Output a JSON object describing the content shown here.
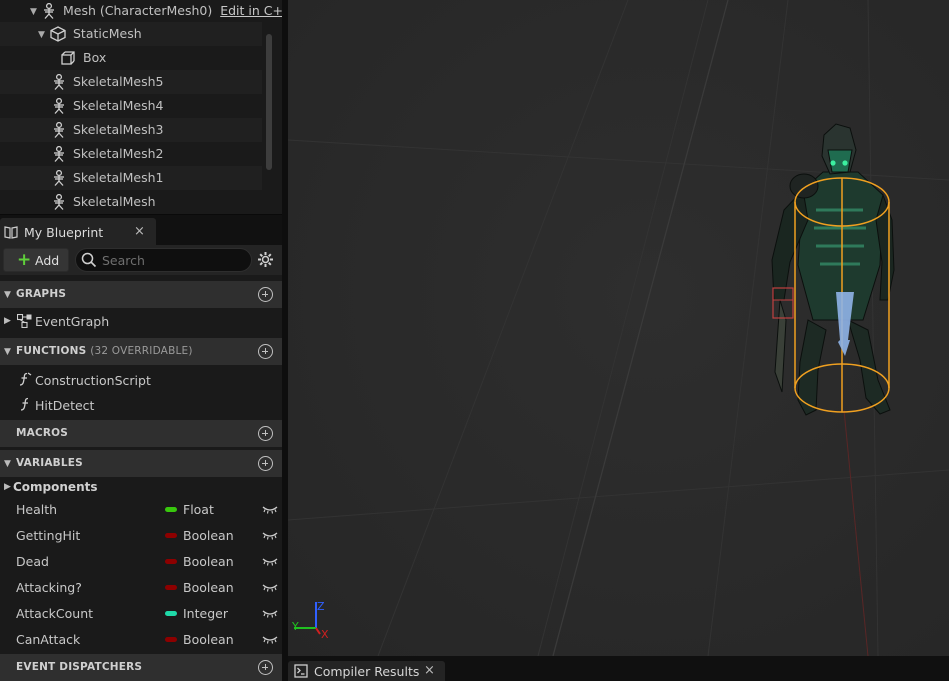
{
  "component_tree": {
    "rows": [
      {
        "label": "Mesh (CharacterMesh0)",
        "icon": "skeleton-icon",
        "edit_link": "Edit in C+"
      },
      {
        "label": "StaticMesh",
        "icon": "cube-icon"
      },
      {
        "label": "Box",
        "icon": "box-collision-icon"
      },
      {
        "label": "SkeletalMesh5",
        "icon": "skeleton-icon"
      },
      {
        "label": "SkeletalMesh4",
        "icon": "skeleton-icon"
      },
      {
        "label": "SkeletalMesh3",
        "icon": "skeleton-icon"
      },
      {
        "label": "SkeletalMesh2",
        "icon": "skeleton-icon"
      },
      {
        "label": "SkeletalMesh1",
        "icon": "skeleton-icon"
      },
      {
        "label": "SkeletalMesh",
        "icon": "skeleton-icon"
      }
    ]
  },
  "my_blueprint_tab": {
    "label": "My Blueprint",
    "close": "×"
  },
  "toolbar": {
    "add_label": "Add",
    "search_placeholder": "Search"
  },
  "sections": {
    "graphs": {
      "title": "GRAPHS",
      "items": [
        {
          "label": "EventGraph",
          "icon": "graph-icon"
        }
      ]
    },
    "functions": {
      "title": "FUNCTIONS",
      "subtitle": "(32 OVERRIDABLE)",
      "items": [
        {
          "label": "ConstructionScript",
          "icon": "construction-function-icon"
        },
        {
          "label": "HitDetect",
          "icon": "function-icon"
        }
      ]
    },
    "macros": {
      "title": "MACROS"
    },
    "variables": {
      "title": "VARIABLES",
      "category": "Components",
      "items": [
        {
          "name": "Health",
          "type": "Float",
          "color": "#38c70d"
        },
        {
          "name": "GettingHit",
          "type": "Boolean",
          "color": "#8d0000"
        },
        {
          "name": "Dead",
          "type": "Boolean",
          "color": "#8d0000"
        },
        {
          "name": "Attacking?",
          "type": "Boolean",
          "color": "#8d0000"
        },
        {
          "name": "AttackCount",
          "type": "Integer",
          "color": "#1fd9a8"
        },
        {
          "name": "CanAttack",
          "type": "Boolean",
          "color": "#8d0000"
        }
      ]
    },
    "event_dispatchers": {
      "title": "EVENT DISPATCHERS"
    }
  },
  "viewport": {
    "axis_labels": {
      "x": "X",
      "y": "Y",
      "z": "Z"
    },
    "colors": {
      "capsule": "#f0a020",
      "arrow": "#8fb4e8",
      "skin": "#1f6b4f",
      "eyes": "#3cf0a0",
      "axis_x": "#d02020",
      "axis_y": "#20c020",
      "axis_z": "#3060ff"
    }
  },
  "bottom_bar": {
    "compiler_tab_label": "Compiler Results",
    "close": "×"
  }
}
